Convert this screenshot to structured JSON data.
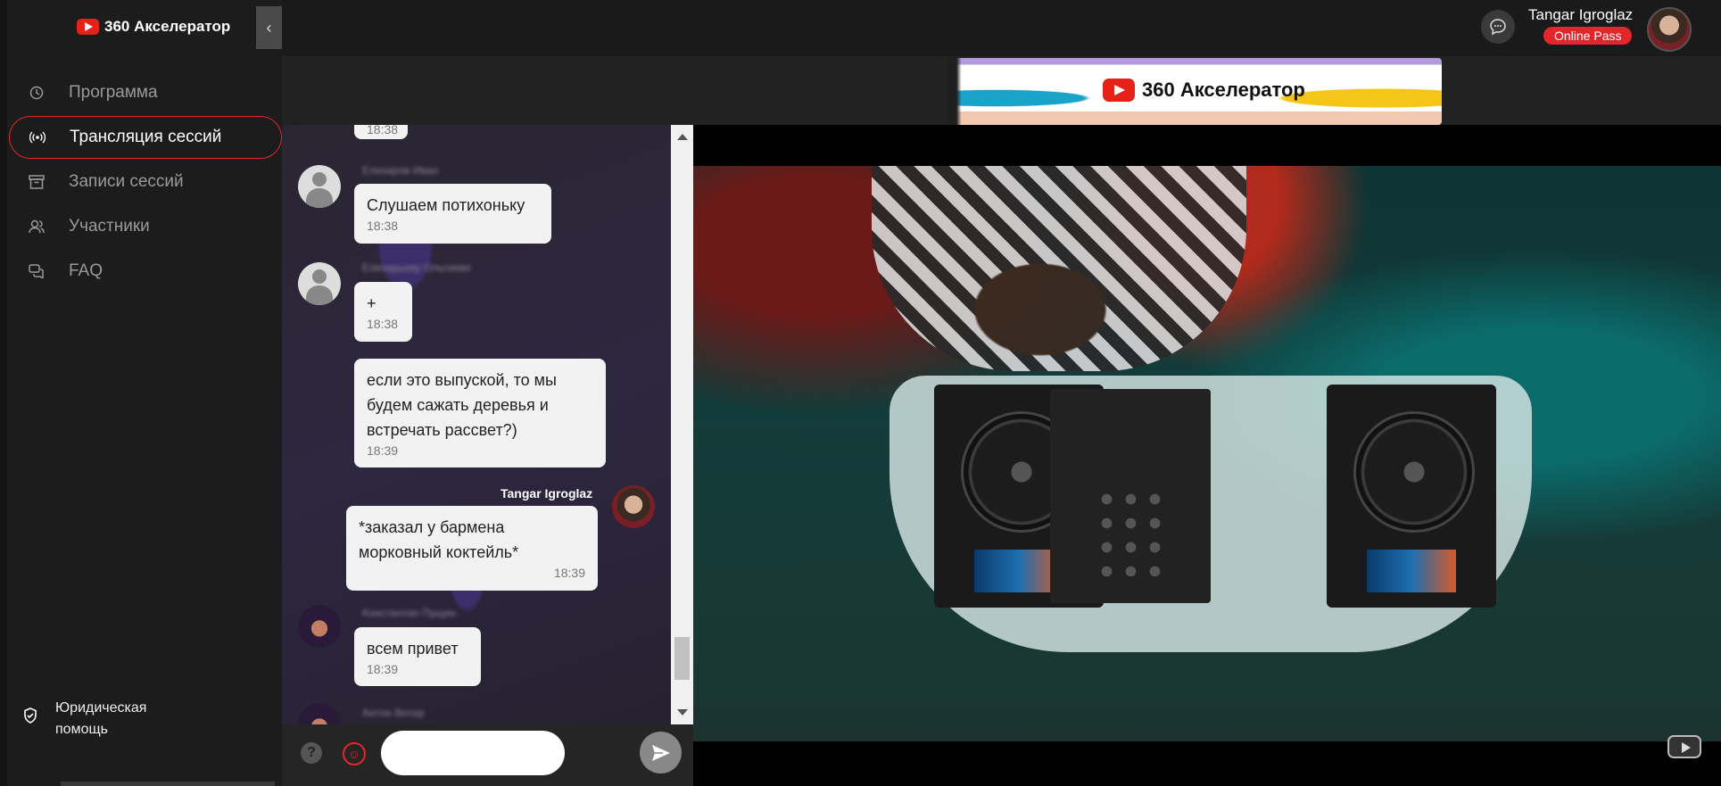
{
  "brand": {
    "name": "360 Акселератор"
  },
  "sidebar": {
    "items": [
      {
        "label": "Программа",
        "icon": "clock-icon",
        "active": false
      },
      {
        "label": "Трансляция сессий",
        "icon": "broadcast-icon",
        "active": true
      },
      {
        "label": "Записи сессий",
        "icon": "archive-icon",
        "active": false
      },
      {
        "label": "Участники",
        "icon": "users-icon",
        "active": false
      },
      {
        "label": "FAQ",
        "icon": "chat-bubbles-icon",
        "active": false
      }
    ],
    "legal": {
      "line1": "Юридическая",
      "line2": "помощь",
      "icon": "shield-check-icon"
    }
  },
  "topbar": {
    "user_name": "Tangar Igroglaz",
    "badge": "Online Pass",
    "chat_icon": "message-dots-icon"
  },
  "banner": {
    "logo_text": "360 Акселератор"
  },
  "chat": {
    "messages": [
      {
        "time": "18:38"
      },
      {
        "sender": "Елизаров Иван",
        "text": "Слушаем потихоньку",
        "time": "18:38"
      },
      {
        "sender": "Елизарьеву Ольгиеве",
        "text": "+",
        "time": "18:38"
      },
      {
        "text": "если это выпуской, то мы будем сажать деревья и встречать рассвет?)",
        "time": "18:39"
      },
      {
        "sender": "Tangar Igroglaz",
        "text": "*заказал у бармена морковный коктейль*",
        "time": "18:39"
      },
      {
        "sender": "Константин Пущин",
        "text": "всем привет",
        "time": "18:39"
      },
      {
        "sender": "Антон Ветер"
      }
    ],
    "input_placeholder": "",
    "colors": {
      "accent": "#e3262b",
      "bubble": "#f2f2f2"
    }
  },
  "video": {
    "player": "youtube",
    "watermark_icon": "youtube-icon"
  }
}
